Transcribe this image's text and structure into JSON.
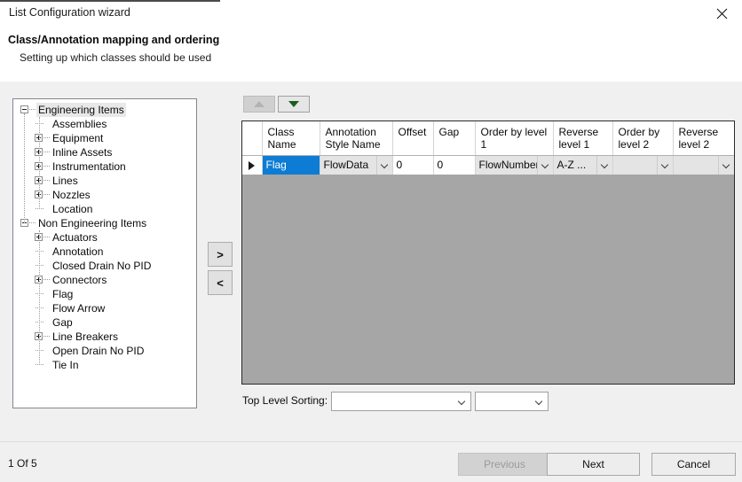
{
  "window": {
    "title": "List Configuration wizard",
    "close_icon": "close-icon"
  },
  "header": {
    "title": "Class/Annotation mapping and ordering",
    "subtitle": "Setting up which classes should be used"
  },
  "tree": {
    "nodes": [
      {
        "label": "Engineering Items",
        "depth": 0,
        "expander": "minus",
        "selected": true
      },
      {
        "label": "Assemblies",
        "depth": 1,
        "expander": "none",
        "selected": false
      },
      {
        "label": "Equipment",
        "depth": 1,
        "expander": "plus",
        "selected": false
      },
      {
        "label": "Inline Assets",
        "depth": 1,
        "expander": "plus",
        "selected": false
      },
      {
        "label": "Instrumentation",
        "depth": 1,
        "expander": "plus",
        "selected": false
      },
      {
        "label": "Lines",
        "depth": 1,
        "expander": "plus",
        "selected": false
      },
      {
        "label": "Nozzles",
        "depth": 1,
        "expander": "plus",
        "selected": false
      },
      {
        "label": "Location",
        "depth": 1,
        "expander": "none",
        "selected": false
      },
      {
        "label": "Non Engineering Items",
        "depth": 0,
        "expander": "minus",
        "selected": false
      },
      {
        "label": "Actuators",
        "depth": 1,
        "expander": "plus",
        "selected": false
      },
      {
        "label": "Annotation",
        "depth": 1,
        "expander": "none",
        "selected": false
      },
      {
        "label": "Closed Drain No PID",
        "depth": 1,
        "expander": "none",
        "selected": false
      },
      {
        "label": "Connectors",
        "depth": 1,
        "expander": "plus",
        "selected": false
      },
      {
        "label": "Flag",
        "depth": 1,
        "expander": "none",
        "selected": false
      },
      {
        "label": "Flow Arrow",
        "depth": 1,
        "expander": "none",
        "selected": false
      },
      {
        "label": "Gap",
        "depth": 1,
        "expander": "none",
        "selected": false
      },
      {
        "label": "Line Breakers",
        "depth": 1,
        "expander": "plus",
        "selected": false
      },
      {
        "label": "Open Drain No PID",
        "depth": 1,
        "expander": "none",
        "selected": false
      },
      {
        "label": "Tie In",
        "depth": 1,
        "expander": "none",
        "selected": false
      }
    ]
  },
  "transfer": {
    "add_label": ">",
    "remove_label": "<"
  },
  "order_buttons": {
    "up_icon": "triangle-up-icon",
    "down_icon": "triangle-down-icon",
    "up_enabled": false,
    "down_enabled": true
  },
  "grid": {
    "columns": [
      "Class\nName",
      "Annotation\nStyle Name",
      "Offset",
      "Gap",
      "Order by level\n1",
      "Reverse\nlevel 1",
      "Order by\nlevel 2",
      "Reverse\nlevel 2"
    ],
    "row": {
      "marker_icon": "row-selector-triangle-icon",
      "class_name": "Flag",
      "annotation_style_name": "FlowData",
      "offset": "0",
      "gap": "0",
      "order_by_level_1": "FlowNumber",
      "reverse_level_1": "A-Z ...",
      "order_by_level_2": "",
      "reverse_level_2": ""
    }
  },
  "top_level_sorting": {
    "label": "Top Level Sorting:",
    "combo_1_value": "",
    "combo_2_value": ""
  },
  "footer": {
    "page_indicator": "1 Of 5",
    "previous_label": "Previous",
    "next_label": "Next",
    "cancel_label": "Cancel"
  },
  "colors": {
    "selection_blue": "#0C7CD5",
    "grid_empty_gray": "#A6A6A6",
    "dialog_gray": "#F0F0F0",
    "down_arrow_green": "#1B5E20"
  }
}
